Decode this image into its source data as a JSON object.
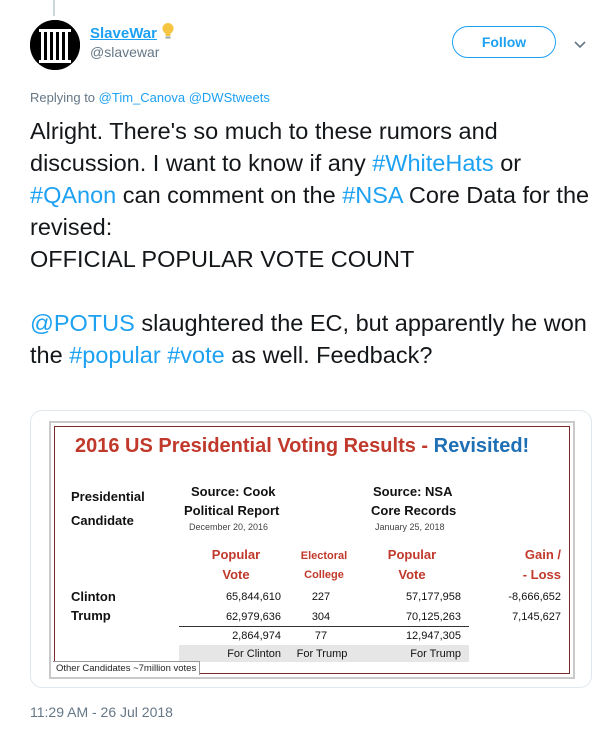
{
  "user": {
    "display_name": "SlaveWar",
    "handle": "@slavewar",
    "follow_label": "Follow"
  },
  "reply": {
    "prefix": "Replying to",
    "mentions": [
      "@Tim_Canova",
      "@DWStweets"
    ]
  },
  "tweet": {
    "t1": "Alright. There's so much to these rumors and discussion. I want to know if any ",
    "h_whitehats": "#WhiteHats",
    "t2": " or ",
    "h_qanon": "#QAnon",
    "t3": " can comment on the ",
    "h_nsa": "#NSA",
    "t4": " Core Data for the revised:",
    "line2": "OFFICIAL POPULAR VOTE COUNT",
    "m_potus": "@POTUS",
    "t5": " slaughtered the EC, but apparently he won the ",
    "h_popular": "#popular",
    "t6": " ",
    "h_vote": "#vote",
    "t7": " as well. Feedback?"
  },
  "image": {
    "title": "2016 US Presidential Voting Results - ",
    "title_accent": "Revisited!",
    "candidate_header_1": "Presidential",
    "candidate_header_2": "Candidate",
    "source1_line1": "Source: Cook",
    "source1_line2": "Political Report",
    "source1_date": "December 20, 2016",
    "source2_line1": "Source: NSA",
    "source2_line2": "Core Records",
    "source2_date": "January 25, 2018",
    "col_popular_1": "Popular",
    "col_popular_2": "Vote",
    "col_electoral_1": "Electoral",
    "col_electoral_2": "College",
    "col_popular2_1": "Popular",
    "col_popular2_2": "Vote",
    "col_gain_1": "Gain /",
    "col_gain_2": "- Loss",
    "rows": [
      {
        "name": "Clinton",
        "pop1": "65,844,610",
        "ec": "227",
        "pop2": "57,177,958",
        "gain": "-8,666,652"
      },
      {
        "name": "Trump",
        "pop1": "62,979,636",
        "ec": "304",
        "pop2": "70,125,263",
        "gain": "7,145,627"
      }
    ],
    "diff": {
      "pop1": "2,864,974",
      "ec": "77",
      "pop2": "12,947,305"
    },
    "for": {
      "pop1": "For Clinton",
      "ec": "For Trump",
      "pop2": "For Trump"
    },
    "footnote": "Other Candidates ~7million votes"
  },
  "timestamp": "11:29 AM - 26 Jul 2018",
  "colors": {
    "link": "#1da1f2",
    "title_red": "#c0392b",
    "title_blue": "#1f6fb5"
  }
}
